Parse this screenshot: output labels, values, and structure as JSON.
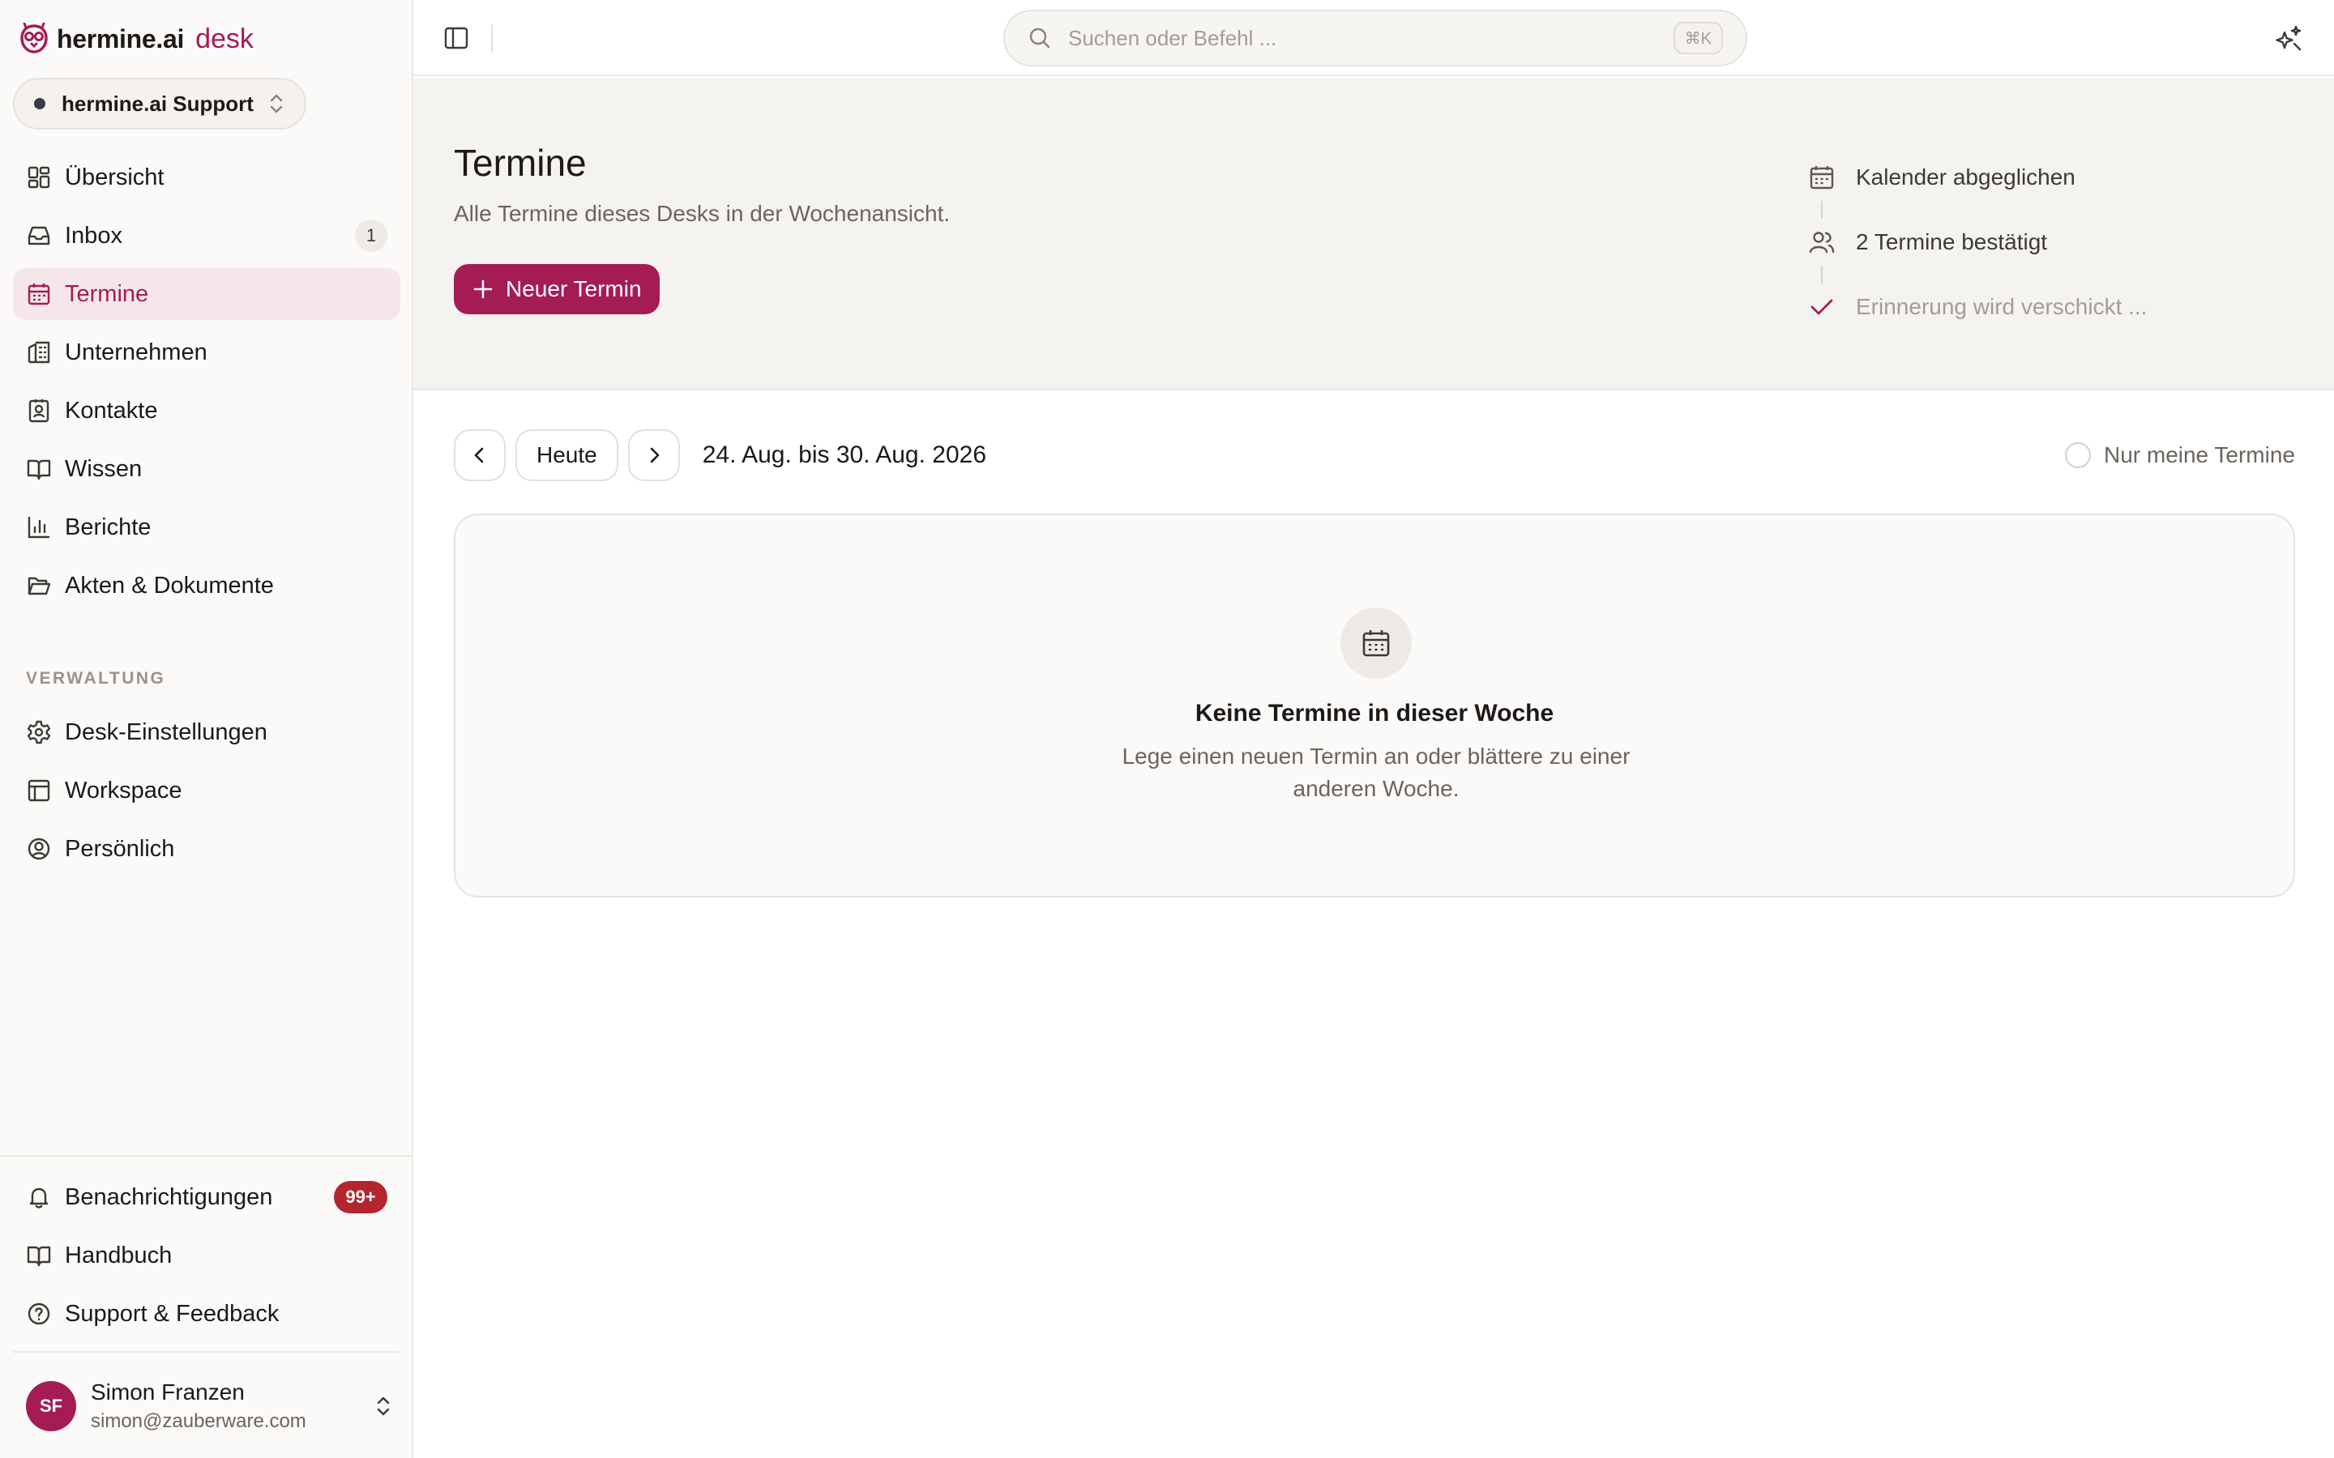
{
  "brand": {
    "name": "hermine.ai",
    "product": "desk",
    "accent": "#a51c55"
  },
  "desk_switcher": {
    "label": "hermine.ai Support"
  },
  "nav": {
    "main": [
      {
        "label": "Übersicht",
        "icon": "dashboard-icon"
      },
      {
        "label": "Inbox",
        "icon": "inbox-icon",
        "count": "1"
      },
      {
        "label": "Termine",
        "icon": "calendar-icon",
        "active": true
      },
      {
        "label": "Unternehmen",
        "icon": "building-icon"
      },
      {
        "label": "Kontakte",
        "icon": "contact-book-icon"
      },
      {
        "label": "Wissen",
        "icon": "book-open-icon"
      },
      {
        "label": "Berichte",
        "icon": "bar-chart-icon"
      },
      {
        "label": "Akten & Dokumente",
        "icon": "folder-open-icon"
      }
    ],
    "section_label": "VERWALTUNG",
    "admin": [
      {
        "label": "Desk-Einstellungen",
        "icon": "gear-icon"
      },
      {
        "label": "Workspace",
        "icon": "layout-icon"
      },
      {
        "label": "Persönlich",
        "icon": "user-circle-icon"
      }
    ],
    "footer": [
      {
        "label": "Benachrichtigungen",
        "icon": "bell-icon",
        "badge": "99+"
      },
      {
        "label": "Handbuch",
        "icon": "book-icon"
      },
      {
        "label": "Support & Feedback",
        "icon": "help-circle-icon"
      }
    ]
  },
  "user": {
    "initials": "SF",
    "name": "Simon Franzen",
    "email": "simon@zauberware.com"
  },
  "topbar": {
    "search_placeholder": "Suchen oder Befehl ...",
    "shortcut": "⌘K"
  },
  "page": {
    "title": "Termine",
    "subtitle": "Alle Termine dieses Desks in der Wochenansicht.",
    "new_button": "Neuer Termin"
  },
  "status_timeline": [
    {
      "text": "Kalender abgeglichen",
      "icon": "calendar-icon",
      "muted": false
    },
    {
      "text": "2 Termine bestätigt",
      "icon": "users-icon",
      "muted": false
    },
    {
      "text": "Erinnerung wird verschickt ...",
      "icon": "check-icon",
      "muted": true
    }
  ],
  "week_nav": {
    "today_label": "Heute",
    "range": "24. Aug. bis 30. Aug. 2026",
    "only_mine_label": "Nur meine Termine"
  },
  "empty_state": {
    "title": "Keine Termine in dieser Woche",
    "text": "Lege einen neuen Termin an oder blättere zu einer anderen Woche."
  }
}
